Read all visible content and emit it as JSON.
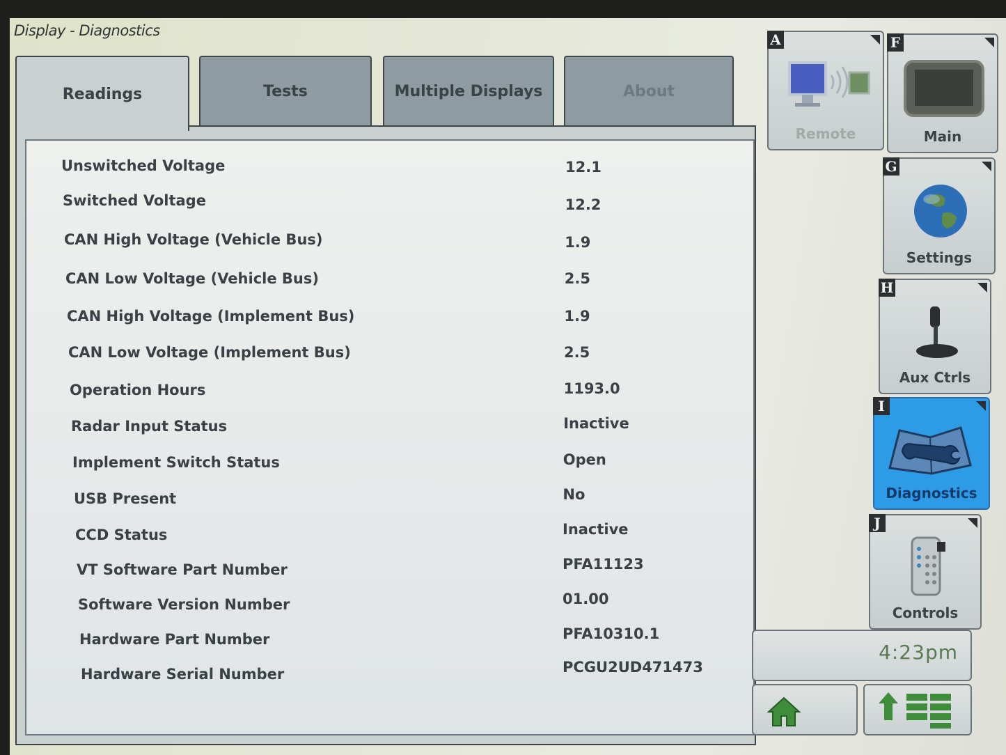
{
  "window": {
    "title": "Display - Diagnostics"
  },
  "tabs": [
    {
      "label": "Readings",
      "state": "active"
    },
    {
      "label": "Tests",
      "state": "normal"
    },
    {
      "label": "Multiple Displays",
      "state": "normal"
    },
    {
      "label": "About",
      "state": "disabled"
    }
  ],
  "readings": [
    {
      "label": "Unswitched Voltage",
      "value": "12.1"
    },
    {
      "label": "Switched Voltage",
      "value": "12.2"
    },
    {
      "label": "CAN High Voltage (Vehicle Bus)",
      "value": "1.9"
    },
    {
      "label": "CAN Low Voltage (Vehicle Bus)",
      "value": "2.5"
    },
    {
      "label": "CAN High Voltage (Implement Bus)",
      "value": "1.9"
    },
    {
      "label": "CAN Low Voltage (Implement Bus)",
      "value": "2.5"
    },
    {
      "label": "Operation Hours",
      "value": "1193.0"
    },
    {
      "label": "Radar Input Status",
      "value": "Inactive"
    },
    {
      "label": "Implement Switch Status",
      "value": "Open"
    },
    {
      "label": "USB Present",
      "value": "No"
    },
    {
      "label": "CCD Status",
      "value": "Inactive"
    },
    {
      "label": "VT Software Part Number",
      "value": "PFA11123"
    },
    {
      "label": "Software Version Number",
      "value": "01.00"
    },
    {
      "label": "Hardware Part Number",
      "value": "PFA10310.1"
    },
    {
      "label": "Hardware Serial Number",
      "value": "PCGU2UD471473"
    }
  ],
  "sidebar": {
    "remote": {
      "letter": "A",
      "label": "Remote",
      "icon": "remote-display-icon"
    },
    "main": {
      "letter": "F",
      "label": "Main",
      "icon": "display-unit-icon"
    },
    "settings": {
      "letter": "G",
      "label": "Settings",
      "icon": "globe-icon"
    },
    "aux_ctrls": {
      "letter": "H",
      "label": "Aux Ctrls",
      "icon": "joystick-icon"
    },
    "diagnostics": {
      "letter": "I",
      "label": "Diagnostics",
      "icon": "wrench-book-icon",
      "selected": true
    },
    "controls": {
      "letter": "J",
      "label": "Controls",
      "icon": "handheld-controller-icon"
    }
  },
  "clock": {
    "time": "4:23pm"
  },
  "nav": {
    "home": {
      "icon": "home-icon"
    },
    "menu": {
      "icon": "up-arrow-menu-icon"
    }
  },
  "colors": {
    "selected_button": "#2d9be6",
    "clock_text": "#5b7a4f",
    "icon_green": "#3f8c3a"
  }
}
